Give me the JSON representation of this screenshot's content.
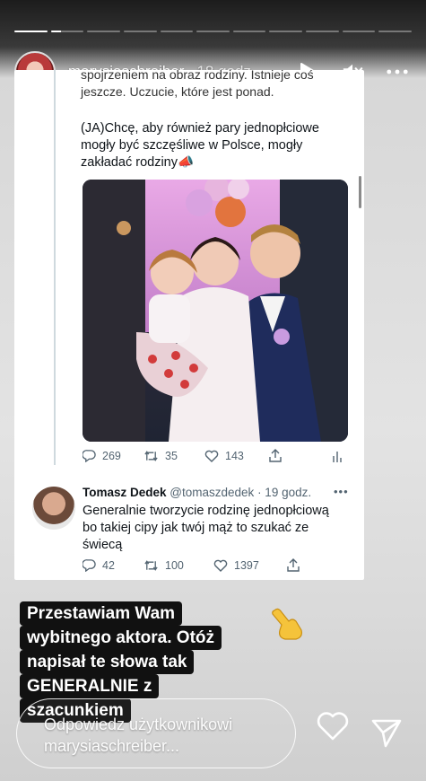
{
  "story": {
    "username": "marysiaschreiber",
    "time_ago": "18 godz.",
    "progress": [
      1.0,
      0.3,
      0,
      0,
      0,
      0,
      0,
      0,
      0,
      0,
      0
    ]
  },
  "tweet": {
    "text_partial_1": "spojrzeniem na obraz rodziny. Istnieje coś",
    "text_partial_2": "jeszcze. Uczucie, które jest ponad.",
    "text_main": "(JA)Chcę, aby również pary jednopłciowe mogły być szczęśliwe w Polsce, mogły zakładać rodziny📣",
    "replies": "269",
    "retweets": "35",
    "likes": "143"
  },
  "reply_tweet": {
    "name": "Tomasz Dedek",
    "handle": "@tomaszdedek",
    "time": "· 19 godz.",
    "text": "Generalnie tworzycie rodzinę jednopłciową bo takiej cipy jak twój mąż to szukać ze świecą",
    "replies": "42",
    "retweets": "100",
    "likes": "1397"
  },
  "caption": {
    "lines": [
      "Przestawiam Wam",
      "wybitnego aktora. Otóż",
      "napisał te słowa tak",
      "GENERALNIE z",
      "szacunkiem"
    ],
    "emoji": "👉"
  },
  "reply_bar": {
    "placeholder": "Odpowiedz użytkownikowi marysiaschreiber..."
  },
  "colors": {
    "accent_white": "#ffffff",
    "twitter_gray": "#536471",
    "caption_bg": "#111111"
  }
}
